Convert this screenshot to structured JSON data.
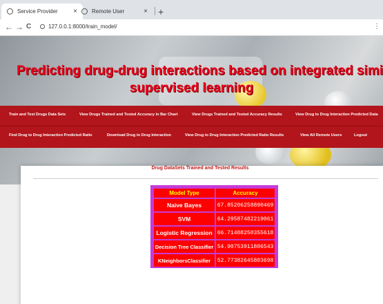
{
  "browser": {
    "tabs": [
      {
        "title": "Service Provider",
        "active": true
      },
      {
        "title": "Remote User",
        "active": false
      }
    ],
    "close_glyph": "×",
    "new_tab_glyph": "+",
    "back_glyph": "←",
    "forward_glyph": "→",
    "reload_glyph": "C",
    "url": "127.0.0.1:8000/train_model/",
    "menu_glyph": "⋮"
  },
  "site": {
    "title_line1": "Predicting drug-drug interactions based on integrated similarity and s",
    "title_line2": "supervised learning",
    "accent_color": "#b2151b",
    "title_color": "#e8001c"
  },
  "menu": {
    "row1": [
      "Train and Test Drugs Data Sets",
      "View Drugs Trained and Tested Accuracy in Bar Chart",
      "View Drugs Trained and Tested Accuracy Results",
      "View Drug to Drug Interaction Predicted Data"
    ],
    "row2": [
      "Find Drug to Drug Interaction Predicted Ratio",
      "Download Drug to Drug Interaction",
      "View Drug to Drug Interaction Predicted Ratio Results",
      "View All Remote Users",
      "Logout"
    ]
  },
  "results": {
    "heading": "Drug DataSets Trained and Tested Results",
    "columns": [
      "Model Type",
      "Accuracy"
    ],
    "rows": [
      {
        "model": "Naive Bayes",
        "accuracy": "67.85206258890469"
      },
      {
        "model": "SVM",
        "accuracy": "64.29587482219061"
      },
      {
        "model": "Logistic Regression",
        "accuracy": "66.71408250355618"
      },
      {
        "model": "Decision Tree Classifier",
        "accuracy": "54.90753911806543"
      },
      {
        "model": "KNeighborsClassifier",
        "accuracy": "52.77382645803698"
      }
    ]
  }
}
